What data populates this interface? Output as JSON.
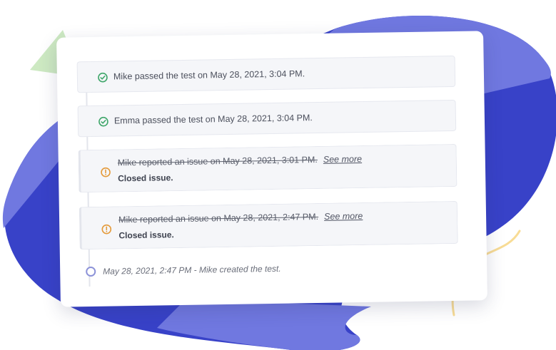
{
  "colors": {
    "blob_light": "#7078e0",
    "blob_dark": "#3842c8",
    "triangle": "#cde9c2",
    "squiggle": "#f8dc95",
    "pass_green": "#3fa66a",
    "issue_orange": "#e49a3a",
    "created_circle": "#8c92d8"
  },
  "timeline": {
    "entries": [
      {
        "type": "passed",
        "icon": "check-circle-icon",
        "text": "Mike passed the test on May 28, 2021, 3:04 PM."
      },
      {
        "type": "passed",
        "icon": "check-circle-icon",
        "text": "Emma passed the test on May 28, 2021, 3:04 PM."
      },
      {
        "type": "issue",
        "icon": "warning-circle-icon",
        "text": "Mike reported an issue on May 28, 2021, 3:01 PM.",
        "link": "See more",
        "status": "Closed issue."
      },
      {
        "type": "issue",
        "icon": "warning-circle-icon",
        "text": "Mike reported an issue on May 28, 2021, 2:47 PM.",
        "link": "See more",
        "status": "Closed issue."
      }
    ],
    "created": {
      "icon": "open-circle-icon",
      "text": "May 28, 2021, 2:47 PM - Mike created the test."
    }
  }
}
